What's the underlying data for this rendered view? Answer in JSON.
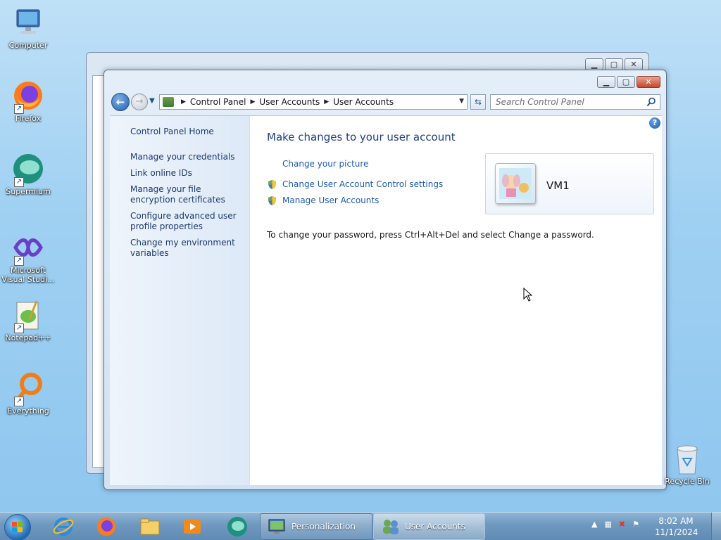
{
  "desktop": {
    "icons": [
      {
        "label": "Computer"
      },
      {
        "label": "Firefox"
      },
      {
        "label": "Supermium"
      },
      {
        "label": "Microsoft Visual Studi..."
      },
      {
        "label": "Notepad++"
      },
      {
        "label": "Everything"
      }
    ],
    "recycle_bin": "Recycle Bin"
  },
  "window": {
    "breadcrumb": [
      "Control Panel",
      "User Accounts",
      "User Accounts"
    ],
    "search_placeholder": "Search Control Panel",
    "sidebar": {
      "home": "Control Panel Home",
      "links": [
        "Manage your credentials",
        "Link online IDs",
        "Manage your file encryption certificates",
        "Configure advanced user profile properties",
        "Change my environment variables"
      ]
    },
    "heading": "Make changes to your user account",
    "tasks": [
      "Change your picture",
      "Change User Account Control settings",
      "Manage User Accounts"
    ],
    "user_name": "VM1",
    "password_note": "To change your password, press Ctrl+Alt+Del and select Change a password."
  },
  "taskbar": {
    "tasks": [
      {
        "label": "Personalization",
        "active": false
      },
      {
        "label": "User Accounts",
        "active": true
      }
    ],
    "clock_time": "8:02 AM",
    "clock_date": "11/1/2024"
  },
  "colors": {
    "link": "#1e5bb0",
    "heading": "#1f3e85",
    "desktop": "#9fd0f2"
  }
}
